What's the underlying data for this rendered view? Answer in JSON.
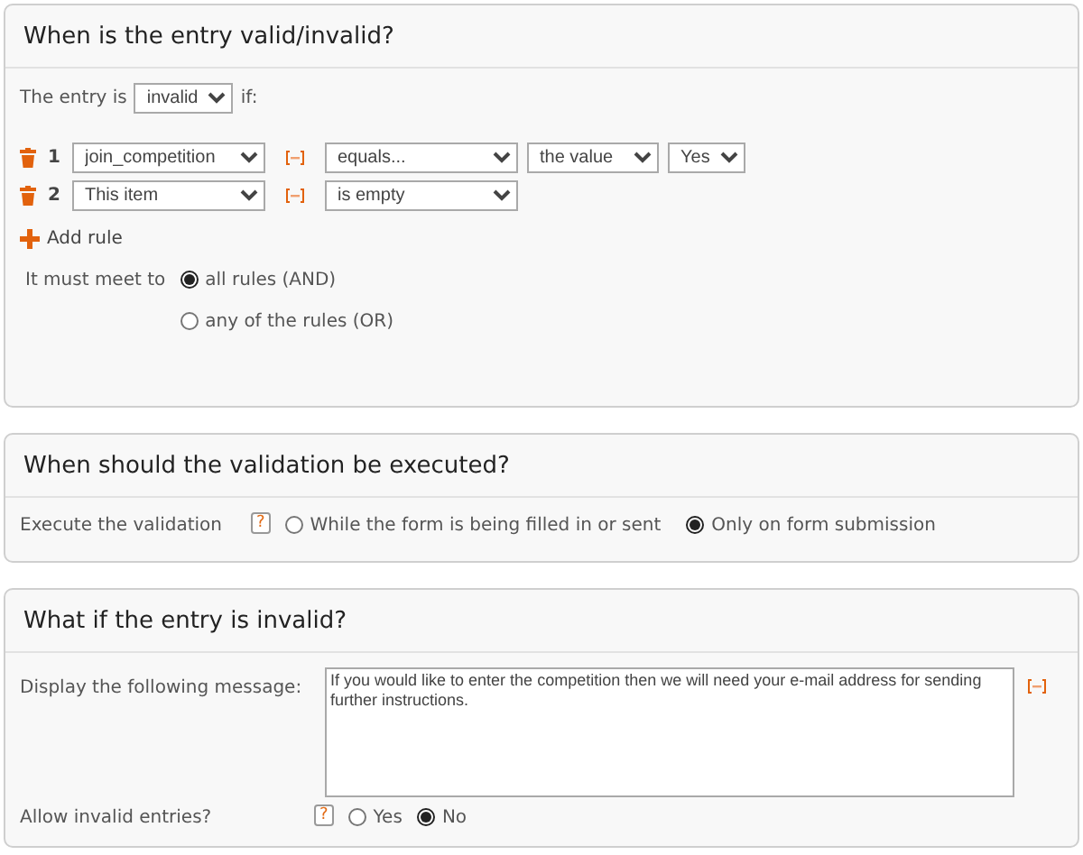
{
  "validity": {
    "title": "When is the entry valid/invalid?",
    "entry_prefix": "The entry is",
    "entry_state": "invalid",
    "entry_suffix": "if:",
    "rules": [
      {
        "number": "1",
        "field": "join_competition",
        "operator": "equals...",
        "compare": "the value",
        "value": "Yes"
      },
      {
        "number": "2",
        "field": "This item",
        "operator": "is empty"
      }
    ],
    "add_rule": "Add rule",
    "match_label": "It must meet to",
    "match_options": [
      {
        "label": "all rules (AND)",
        "selected": true
      },
      {
        "label": "any of the rules (OR)",
        "selected": false
      }
    ]
  },
  "execution": {
    "title": "When should the validation be executed?",
    "label": "Execute the validation",
    "help": "?",
    "options": [
      {
        "label": "While the form is being filled in or sent",
        "selected": false
      },
      {
        "label": "Only on form submission",
        "selected": true
      }
    ]
  },
  "invalid": {
    "title": "What if the entry is invalid?",
    "message_label": "Display the following message:",
    "message": "If you would like to enter the competition then we will need your e-mail address for sending further instructions.",
    "allow_label": "Allow invalid entries?",
    "help": "?",
    "options": [
      {
        "label": "Yes",
        "selected": false
      },
      {
        "label": "No",
        "selected": true
      }
    ]
  }
}
